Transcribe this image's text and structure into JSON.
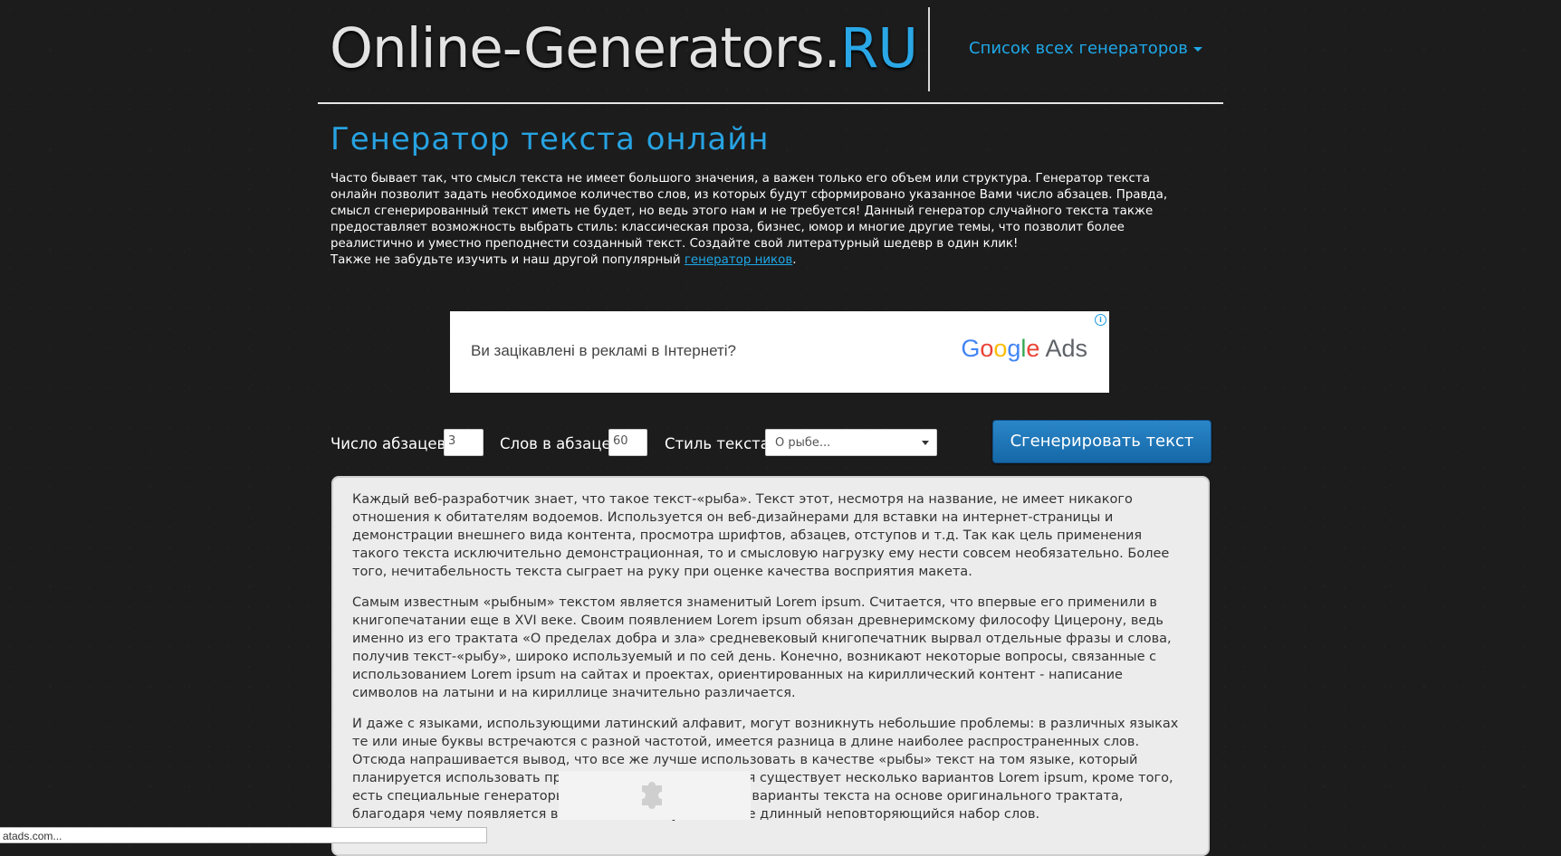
{
  "header": {
    "logo_main": "Online-Generators.",
    "logo_tld": "RU",
    "nav_link": "Список всех генераторов"
  },
  "page": {
    "title": "Генератор текста онлайн",
    "intro": "Часто бывает так, что смысл текста не имеет большого значения, а важен только его объем или структура. Генератор текста онлайн позволит задать необходимое количество слов, из которых будут сформировано указанное Вами число абзацев. Правда, смысл сгенерированный текст иметь не будет, но ведь этого нам и не требуется! Данный генератор случайного текста также предоставляет возможность выбрать стиль: классическая проза, бизнес, юмор и многие другие темы, что позволит более реалистично и уместно преподнести созданный текст. Создайте свой литературный шедевр в один клик!",
    "intro_line2_prefix": "Также не забудьте изучить и наш другой популярный ",
    "intro_link": "генератор ников",
    "intro_line2_suffix": "."
  },
  "ad": {
    "text": "Ви зацікавлені в рекламі в Інтернеті?",
    "logo_word1": "Google",
    "logo_word2": "Ads",
    "info_icon": "i"
  },
  "controls": {
    "paragraphs_label": "Число абзацев:",
    "paragraphs_value": "3",
    "words_label": "Слов в абзаце:",
    "words_value": "60",
    "style_label": "Стиль текста:",
    "style_value": "О рыбе...",
    "generate_button": "Сгенерировать текст"
  },
  "output": {
    "paragraphs": [
      "Каждый веб-разработчик знает, что такое текст-«рыба». Текст этот, несмотря на название, не имеет никакого отношения к обитателям водоемов. Используется он веб-дизайнерами для вставки на интернет-страницы и демонстрации внешнего вида контента, просмотра шрифтов, абзацев, отступов и т.д. Так как цель применения такого текста исключительно демонстрационная, то и смысловую нагрузку ему нести совсем необязательно. Более того, нечитабельность текста сыграет на руку при оценке качества восприятия макета.",
      "Самым известным «рыбным» текстом является знаменитый Lorem ipsum. Считается, что впервые его применили в книгопечатании еще в XVI веке. Своим появлением Lorem ipsum обязан древнеримскому философу Цицерону, ведь именно из его трактата «О пределах добра и зла» средневековый книгопечатник вырвал отдельные фразы и слова, получив текст-«рыбу», широко используемый и по сей день. Конечно, возникают некоторые вопросы, связанные с использованием Lorem ipsum на сайтах и проектах, ориентированных на кириллический контент - написание символов на латыни и на кириллице значительно различается.",
      "И даже с языками, использующими латинский алфавит, могут возникнуть небольшие проблемы: в различных языках те или иные буквы встречаются с разной частотой, имеется разница в длине наиболее распространенных слов. Отсюда напрашивается вывод, что все же лучше использовать в качестве «рыбы» текст на том языке, который планируется использовать при запуске проекта. Сегодня существует несколько вариантов Lorem ipsum, кроме того, есть специальные генераторы, создающие собственные варианты текста на основе оригинального трактата, благодаря чему появляется возможность получить более длинный неповторяющийся набор слов."
    ]
  },
  "statusbar": {
    "text": "atads.com..."
  },
  "colors": {
    "accent": "#1fa8e8",
    "button": "#1f75b8",
    "background": "#1c1c1c"
  }
}
